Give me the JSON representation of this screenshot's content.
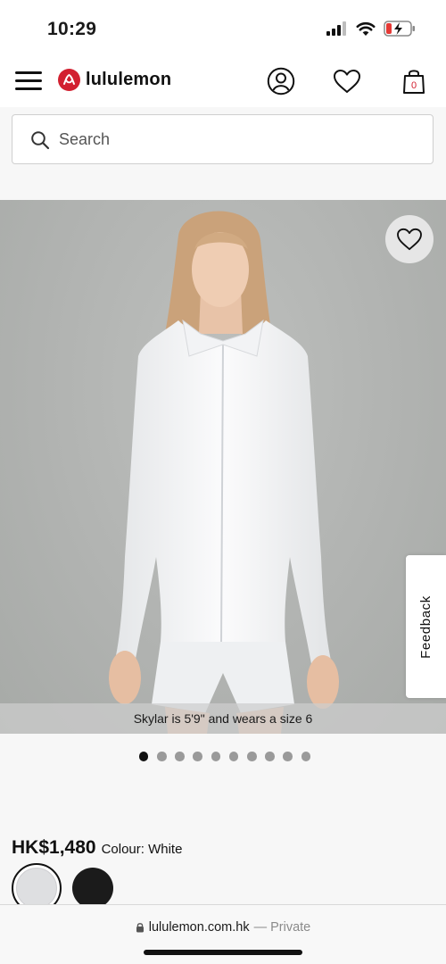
{
  "status_bar": {
    "time": "10:29"
  },
  "header": {
    "brand": "lululemon",
    "cart_count": "0",
    "icons": [
      "menu-icon",
      "lululemon-logo",
      "account-icon",
      "wishlist-icon",
      "bag-icon"
    ]
  },
  "search": {
    "placeholder": "Search"
  },
  "product": {
    "caption": "Skylar is 5'9\" and wears a size 6",
    "feedback_label": "Feedback",
    "image_count": 10,
    "active_image_index": 0,
    "price": "HK$1,480",
    "colour_label": "Colour: White",
    "swatches": [
      {
        "name": "White",
        "color": "#dedfe1",
        "selected": true
      },
      {
        "name": "Black",
        "color": "#1b1b1b",
        "selected": false
      }
    ]
  },
  "browser": {
    "domain": "lululemon.com.hk",
    "privacy": "— Private"
  },
  "colors": {
    "brand_red": "#d22030",
    "image_bg": "#b1b3b1"
  }
}
